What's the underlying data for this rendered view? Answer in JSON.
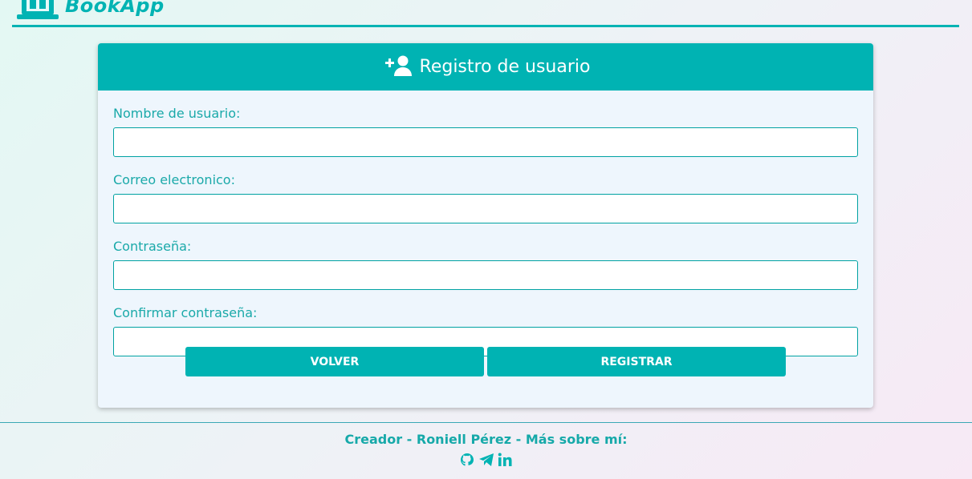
{
  "brand": {
    "name": "BookApp",
    "icon": "book-laptop-icon"
  },
  "card": {
    "title": "Registro de usuario",
    "icon": "add-user-icon",
    "fields": [
      {
        "label": "Nombre de usuario:",
        "value": ""
      },
      {
        "label": "Correo electronico:",
        "value": ""
      },
      {
        "label": "Contraseña:",
        "value": ""
      },
      {
        "label": "Confirmar contraseña:",
        "value": ""
      }
    ],
    "buttons": {
      "back": "VOLVER",
      "register": "REGISTRAR"
    }
  },
  "footer": {
    "text": "Creador - Roniell Pérez - Más sobre mí:",
    "social": [
      "github-icon",
      "telegram-icon",
      "linkedin-icon"
    ]
  },
  "colors": {
    "accent": "#00b3b3",
    "card_bg": "#eef6fd"
  }
}
